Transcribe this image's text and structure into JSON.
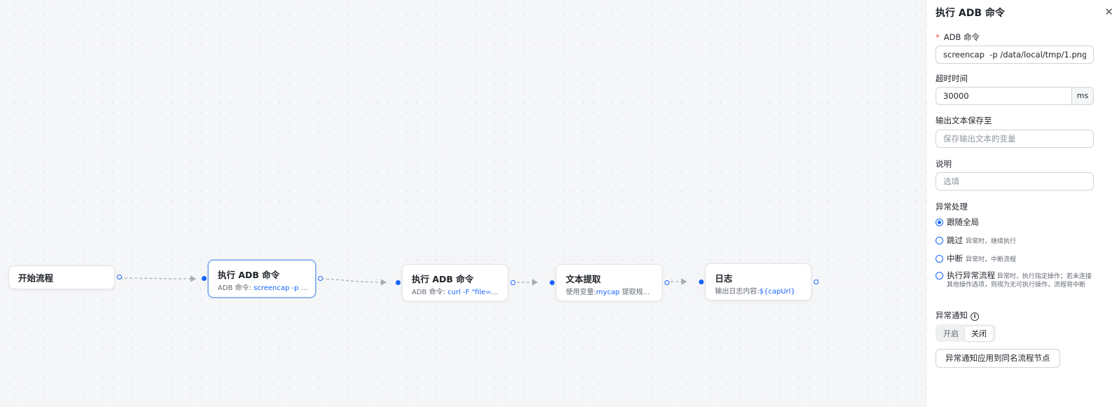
{
  "flow": {
    "nodes": [
      {
        "title": "开始流程",
        "sub_label": "",
        "sub_value": ""
      },
      {
        "title": "执行 ADB 命令",
        "sub_label": "ADB 命令:",
        "sub_value": "screencap -p /..."
      },
      {
        "title": "执行 ADB 命令",
        "sub_label": "ADB 命令:",
        "sub_value": "curl -F \"file=@..."
      },
      {
        "title": "文本提取",
        "sub_label": "使用变量:",
        "sub_value": "mycap",
        "sub_tail": "提取规则..."
      },
      {
        "title": "日志",
        "sub_label": "输出日志内容:",
        "sub_value": "${capUrl}"
      }
    ]
  },
  "panel": {
    "title": "执行 ADB 命令",
    "close_icon": "close-icon",
    "adb": {
      "required_mark": "*",
      "label": "ADB 命令",
      "value": "screencap  -p /data/local/tmp/1.png"
    },
    "timeout": {
      "label": "超时时间",
      "value": "30000",
      "unit": "ms"
    },
    "output": {
      "label": "输出文本保存至",
      "placeholder": "保存输出文本的变量"
    },
    "desc": {
      "label": "说明",
      "placeholder": "选填"
    },
    "exception": {
      "label": "异常处理",
      "options": [
        {
          "label": "跟随全局",
          "hint": "",
          "selected": true
        },
        {
          "label": "跳过",
          "hint": "异常时，继续执行",
          "selected": false
        },
        {
          "label": "中断",
          "hint": "异常时，中断流程",
          "selected": false
        },
        {
          "label": "执行异常流程",
          "hint": "异常时，执行指定操作；若未连接其他操作选项，则视为无可执行操作，流程将中断",
          "selected": false
        }
      ]
    },
    "notify": {
      "label": "异常通知",
      "info_icon": "info-icon",
      "on_label": "开启",
      "off_label": "关闭",
      "selected": "关闭"
    },
    "apply_button": "异常通知应用到同名流程节点"
  },
  "colors": {
    "accent": "#1664ff",
    "selected_border": "#7aa7ea",
    "required": "#f54a45"
  }
}
